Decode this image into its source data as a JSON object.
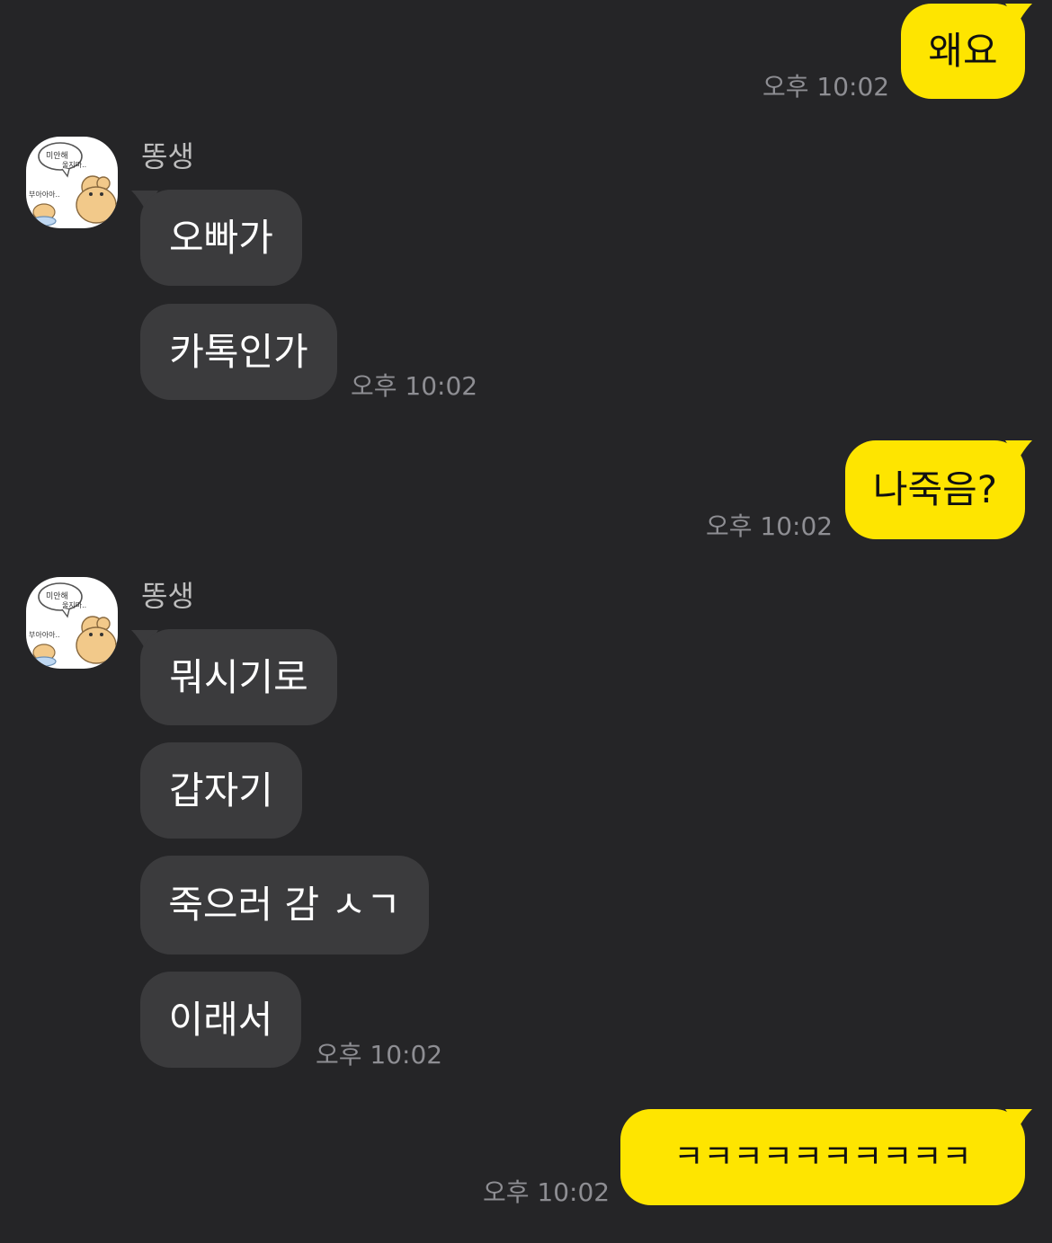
{
  "colors": {
    "background": "#252527",
    "outgoing_bubble": "#FEE500",
    "incoming_bubble": "#3B3B3D",
    "timestamp": "#8E8E93",
    "sender_name": "#BDBDBD"
  },
  "messages": [
    {
      "direction": "out",
      "text": "왜요",
      "time": "오후 10:02"
    },
    {
      "direction": "in_group",
      "sender": "똥생",
      "avatar_icon": "bear-sticker-avatar-icon",
      "avatar_text": [
        "미안해",
        "울지마..",
        "부아아아.."
      ],
      "bubbles": [
        {
          "text": "오빠가"
        },
        {
          "text": "카톡인가"
        }
      ],
      "time": "오후 10:02"
    },
    {
      "direction": "out",
      "text": "나죽음?",
      "time": "오후 10:02"
    },
    {
      "direction": "in_group",
      "sender": "똥생",
      "avatar_icon": "bear-sticker-avatar-icon",
      "avatar_text": [
        "미안해",
        "울지마..",
        "부아아아.."
      ],
      "bubbles": [
        {
          "text": "뭐시기로"
        },
        {
          "text": "갑자기"
        },
        {
          "text": "죽으러 감 ㅅㄱ"
        },
        {
          "text": "이래서"
        }
      ],
      "time": "오후 10:02"
    },
    {
      "direction": "out",
      "text": "ㅋㅋㅋㅋㅋㅋㅋㅋㅋㅋ",
      "time": "오후 10:02"
    }
  ]
}
